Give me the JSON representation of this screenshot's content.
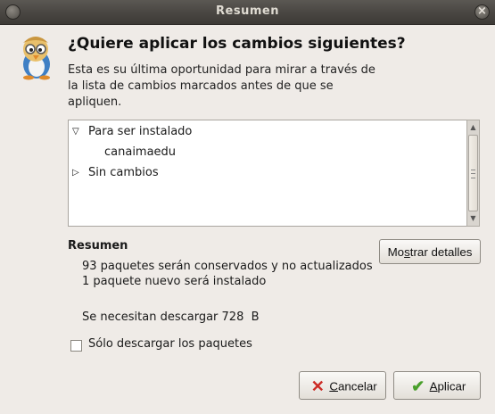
{
  "window": {
    "title": "Resumen"
  },
  "heading": "¿Quiere aplicar los cambios siguientes?",
  "description": "Esta es su última oportunidad para mirar a través de la lista de cambios marcados antes de que se apliquen.",
  "tree": {
    "items": [
      {
        "label": "Para ser instalado",
        "expanded": true
      },
      {
        "label": "canaimaedu"
      },
      {
        "label": "Sin cambios",
        "expanded": false
      }
    ]
  },
  "summary": {
    "title": "Resumen",
    "lines": [
      "93 paquetes serán conservados y no actualizados",
      "1 paquete nuevo será instalado",
      "Se necesitan descargar 728  B"
    ]
  },
  "buttons": {
    "details": {
      "pre": "Mo",
      "mn": "s",
      "post": "trar detalles"
    },
    "cancel": {
      "pre": "",
      "mn": "C",
      "post": "ancelar"
    },
    "apply": {
      "pre": "",
      "mn": "A",
      "post": "plicar"
    }
  },
  "options": {
    "download_only": "Sólo descargar los paquetes",
    "download_only_checked": false
  },
  "icons": {
    "mascot": "penguin-mascot-icon",
    "cancel": "cancel-x-icon",
    "apply": "checkmark-icon"
  },
  "colors": {
    "titlebar": "#4a4743",
    "cancel_icon": "#cc2b25",
    "apply_icon": "#4aa02c"
  }
}
